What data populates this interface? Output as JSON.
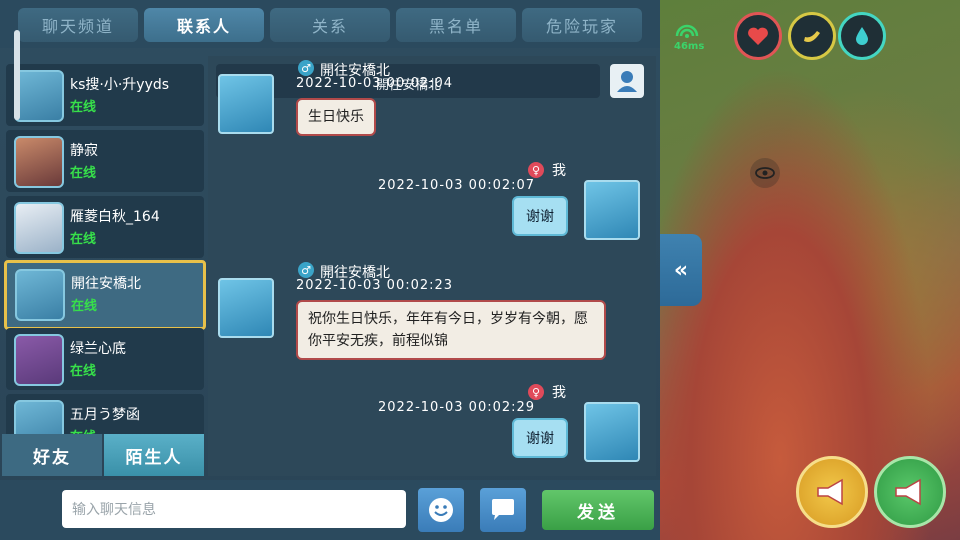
{
  "tabs": [
    "聊天频道",
    "联系人",
    "关系",
    "黑名单",
    "危险玩家"
  ],
  "active_tab": "联系人",
  "contacts": [
    {
      "name": "ks搜·小·升yyds",
      "status": "在线"
    },
    {
      "name": "静寂",
      "status": "在线"
    },
    {
      "name": "雁菱白秋_164",
      "status": "在线"
    },
    {
      "name": "開往安橋北",
      "status": "在线",
      "selected": true
    },
    {
      "name": "绿兰心底",
      "status": "在线"
    },
    {
      "name": "五月う梦函",
      "status": "在线"
    }
  ],
  "bottom_tabs": {
    "friends": "好友",
    "strangers": "陌生人"
  },
  "chat": {
    "header_name": "開往安橋北",
    "top_msg_name": "開往安橋北",
    "top_msg_time": "2022-10-03 00:02:04",
    "messages": [
      {
        "side": "left",
        "name": "開往安橋北",
        "text": "生日快乐"
      },
      {
        "side": "right",
        "name": "我",
        "time": "2022-10-03   00:02:07",
        "text": "谢谢"
      },
      {
        "side": "left",
        "name": "開往安橋北",
        "time": "2022-10-03   00:02:23",
        "text": "祝你生日快乐，年年有今日，岁岁有今朝，愿你平安无疾，前程似锦"
      },
      {
        "side": "right",
        "name": "我",
        "time": "2022-10-03   00:02:29",
        "text": "谢谢"
      }
    ]
  },
  "input": {
    "placeholder": "输入聊天信息",
    "value": ""
  },
  "send_label": "发送",
  "hud": {
    "ping": "46ms"
  },
  "colors": {
    "accent": "#e8c14a",
    "online": "#37e04a",
    "send": "#4cb556"
  }
}
